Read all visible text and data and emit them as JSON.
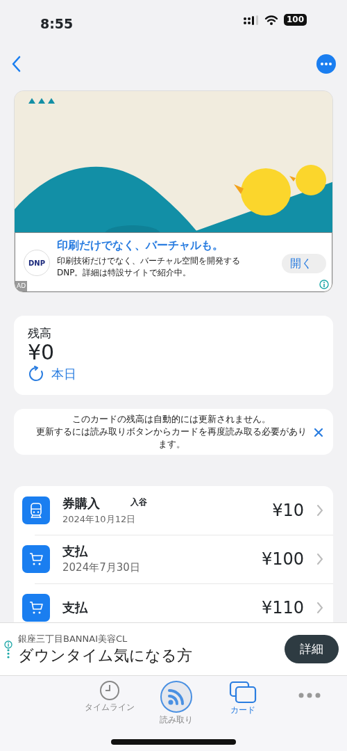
{
  "status_bar": {
    "time": "8:55",
    "battery": "100"
  },
  "banner_ad": {
    "kind": "picture",
    "brand": "DNP",
    "title": "印刷だけでなく、バーチャルも。",
    "body": "印刷技術だけでなく、バーチャル空間を開発する DNP。詳細は特設サイトで紹介中。",
    "button": "開く",
    "ad_label": "AD"
  },
  "balance": {
    "label": "残高",
    "amount": "¥0",
    "updated": "本日"
  },
  "notice": {
    "lines": [
      "このカードの残高は自動的には更新されません。",
      "更新するには読み取りボタンからカードを再度読み取る必要があります。"
    ]
  },
  "transactions": [
    {
      "kind": "train",
      "title": "券購入",
      "station": "入谷",
      "date": "2024年10月12日",
      "amount": "¥10"
    },
    {
      "kind": "shop",
      "title": "支払",
      "date": "2024年7月30日",
      "amount": "¥100"
    },
    {
      "kind": "shop",
      "title": "支払",
      "amount": "¥110"
    }
  ],
  "bottom_ad": {
    "advertiser": "銀座三丁目BANNAI美容CL",
    "headline": "ダウンタイム気になる方",
    "button": "詳細"
  },
  "tabs": [
    {
      "kind": "timeline",
      "label": "タイムライン",
      "selected": false
    },
    {
      "kind": "scan",
      "label": "読み取り",
      "selected": false
    },
    {
      "kind": "cards",
      "label": "カード",
      "selected": true
    },
    {
      "kind": "more",
      "selected": false
    }
  ]
}
